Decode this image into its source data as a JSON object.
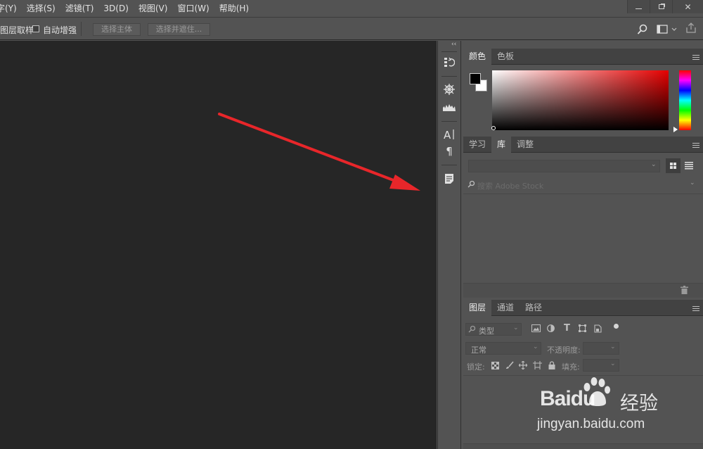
{
  "menubar": {
    "items": [
      "字(Y)",
      "选择(S)",
      "滤镜(T)",
      "3D(D)",
      "视图(V)",
      "窗口(W)",
      "帮助(H)"
    ]
  },
  "options": {
    "sample_label": "图层取样",
    "auto_enhance_label": "自动增强",
    "select_subject": "选择主体",
    "select_mask": "选择并遮住..."
  },
  "color_panel": {
    "tabs": [
      "颜色",
      "色板"
    ]
  },
  "libraries_panel": {
    "tabs": [
      "学习",
      "库",
      "调整"
    ],
    "search_placeholder": "搜索 Adobe Stock"
  },
  "layers_panel": {
    "tabs": [
      "图层",
      "通道",
      "路径"
    ],
    "filter_label": "类型",
    "blend_mode": "正常",
    "opacity_label": "不透明度:",
    "lock_label": "锁定:",
    "fill_label": "填充:"
  },
  "watermark": {
    "brand": "Baidu",
    "cn": "经验",
    "url": "jingyan.baidu.com"
  },
  "colors": {
    "annotation_arrow": "#e8262a",
    "canvas_bg": "#262626",
    "panel_bg": "#535353"
  }
}
